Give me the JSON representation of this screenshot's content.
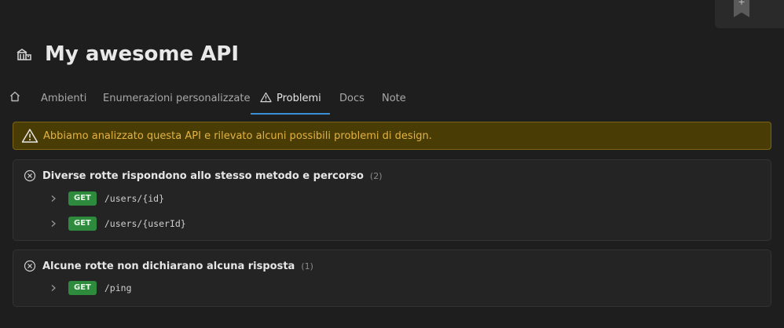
{
  "app": {
    "title": "My awesome API",
    "icon": "api-building-icon"
  },
  "corner": {
    "icon": "bookmark-add-icon",
    "plus": "+"
  },
  "tabs": [
    {
      "label": "",
      "icon": "home-icon",
      "active": false
    },
    {
      "label": "Ambienti",
      "active": false
    },
    {
      "label": "Enumerazioni personalizzate",
      "active": false
    },
    {
      "label": "Problemi",
      "icon": "warning-icon",
      "active": true
    },
    {
      "label": "Docs",
      "active": false
    },
    {
      "label": "Note",
      "active": false
    }
  ],
  "alert": {
    "text": "Abbiamo analizzato questa API e rilevato alcuni possibili problemi di design.",
    "icon": "warning-icon",
    "color_bg": "#4a3c05",
    "color_text": "#e3b341"
  },
  "issues": [
    {
      "title": "Diverse rotte rispondono allo stesso metodo e percorso",
      "count": "(2)",
      "icon": "error-circle-icon",
      "routes": [
        {
          "method": "GET",
          "path": "/users/{id}"
        },
        {
          "method": "GET",
          "path": "/users/{userId}"
        }
      ]
    },
    {
      "title": "Alcune rotte non dichiarano alcuna risposta",
      "count": "(1)",
      "icon": "error-circle-icon",
      "routes": [
        {
          "method": "GET",
          "path": "/ping"
        }
      ]
    }
  ],
  "colors": {
    "accent": "#3b8fd9",
    "get_badge": "#2e8b3e"
  }
}
